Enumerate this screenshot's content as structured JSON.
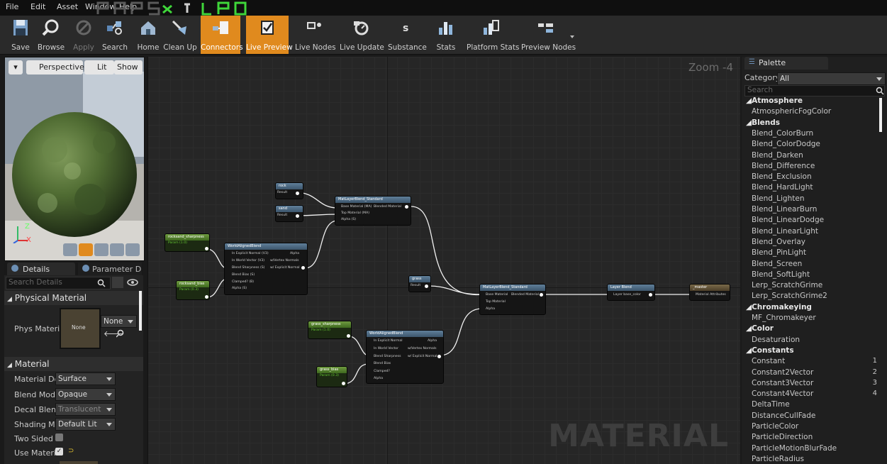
{
  "menu": {
    "file": "File",
    "edit": "Edit",
    "asset": "Asset",
    "window": "Window",
    "help": "Help"
  },
  "toolbar": {
    "save": "Save",
    "browse": "Browse",
    "apply": "Apply",
    "search": "Search",
    "home": "Home",
    "cleanup": "Clean Up",
    "connectors": "Connectors",
    "live_preview": "Live Preview",
    "live_nodes": "Live Nodes",
    "live_update": "Live Update",
    "substance": "Substance",
    "stats": "Stats",
    "platform_stats": "Platform Stats",
    "preview_nodes": "Preview Nodes"
  },
  "viewport": {
    "perspective": "Perspective",
    "lit": "Lit",
    "show": "Show",
    "axis_z": "Z",
    "axis_x": "X"
  },
  "details": {
    "tab_details": "Details",
    "tab_params": "Parameter D",
    "search_placeholder": "Search Details",
    "physical_section": "Physical Material",
    "phys_label": "Phys Materi",
    "phys_thumb": "None",
    "phys_value": "None",
    "material_section": "Material",
    "domain_label": "Material Dor",
    "domain_value": "Surface",
    "blend_label": "Blend Mode",
    "blend_value": "Opaque",
    "decal_label": "Decal Blend",
    "decal_value": "Translucent",
    "shading_label": "Shading Mo",
    "shading_value": "Default Lit",
    "twosided_label": "Two Sided",
    "usemat_label": "Use Materia"
  },
  "graph": {
    "zoom": "Zoom -4",
    "watermark": "MATERIAL",
    "nodes": {
      "rock": {
        "title": "rock",
        "out": "Result"
      },
      "sand": {
        "title": "sand",
        "out": "Result"
      },
      "blend1": {
        "title": "MatLayerBlend_Standard",
        "p1": "Base Material (MA)",
        "o1": "Blended Material",
        "p2": "Top Material (MA)",
        "p3": "Alpha (S)"
      },
      "rocksharp": {
        "title": "rocksand_sharpness",
        "sub": "Param (1.0)"
      },
      "rockbias": {
        "title": "rocksand_bias",
        "sub": "Param (0.3)"
      },
      "wab1": {
        "title": "WorldAlignedBlend",
        "p1": "In Explicit Normal (V3)",
        "o1": "Alpha",
        "p2": "In World Vector (V3)",
        "o2": "w/Vertex Normals",
        "p3": "Blend Sharpness (S)",
        "o3": "w/ Explicit Normal",
        "p4": "Blend Bias (S)",
        "p5": "Clamped? (B)",
        "p6": "Alpha (S)"
      },
      "grass": {
        "title": "grass",
        "out": "Result"
      },
      "blend2": {
        "title": "MatLayerBlend_Standard",
        "p1": "Base Material",
        "o1": "Blended Material",
        "p2": "Top Material",
        "p3": "Alpha"
      },
      "grasssharp": {
        "title": "grass_sharpness",
        "sub": "Param (1.0)"
      },
      "grassbias": {
        "title": "grass_bias",
        "sub": "Param (0.3)"
      },
      "wab2": {
        "title": "WorldAlignedBlend",
        "p1": "In Explicit Normal",
        "o1": "Alpha",
        "p2": "In World Vector",
        "o2": "w/Vertex Normals",
        "p3": "Blend Sharpness",
        "o3": "w/ Explicit Normal",
        "p4": "Blend Bias",
        "p5": "Clamped?",
        "p6": "Alpha"
      },
      "layer": {
        "title": "Layer Blend",
        "p1": "Layer base_color"
      },
      "master": {
        "title": "_master",
        "p1": "Material Attributes"
      }
    }
  },
  "palette": {
    "tab": "Palette",
    "category_label": "Category",
    "category_value": "All",
    "search_placeholder": "Search",
    "items": [
      {
        "t": "c",
        "text": "Atmosphere"
      },
      {
        "t": "i",
        "text": "AtmosphericFogColor"
      },
      {
        "t": "c",
        "text": "Blends"
      },
      {
        "t": "i",
        "text": "Blend_ColorBurn"
      },
      {
        "t": "i",
        "text": "Blend_ColorDodge"
      },
      {
        "t": "i",
        "text": "Blend_Darken"
      },
      {
        "t": "i",
        "text": "Blend_Difference"
      },
      {
        "t": "i",
        "text": "Blend_Exclusion"
      },
      {
        "t": "i",
        "text": "Blend_HardLight"
      },
      {
        "t": "i",
        "text": "Blend_Lighten"
      },
      {
        "t": "i",
        "text": "Blend_LinearBurn"
      },
      {
        "t": "i",
        "text": "Blend_LinearDodge"
      },
      {
        "t": "i",
        "text": "Blend_LinearLight"
      },
      {
        "t": "i",
        "text": "Blend_Overlay"
      },
      {
        "t": "i",
        "text": "Blend_PinLight"
      },
      {
        "t": "i",
        "text": "Blend_Screen"
      },
      {
        "t": "i",
        "text": "Blend_SoftLight"
      },
      {
        "t": "i",
        "text": "Lerp_ScratchGrime"
      },
      {
        "t": "i",
        "text": "Lerp_ScratchGrime2"
      },
      {
        "t": "c",
        "text": "Chromakeying"
      },
      {
        "t": "i",
        "text": "MF_Chromakeyer"
      },
      {
        "t": "c",
        "text": "Color"
      },
      {
        "t": "i",
        "text": "Desaturation"
      },
      {
        "t": "c",
        "text": "Constants"
      },
      {
        "t": "i",
        "text": "Constant",
        "n": "1"
      },
      {
        "t": "i",
        "text": "Constant2Vector",
        "n": "2"
      },
      {
        "t": "i",
        "text": "Constant3Vector",
        "n": "3"
      },
      {
        "t": "i",
        "text": "Constant4Vector",
        "n": "4"
      },
      {
        "t": "i",
        "text": "DeltaTime"
      },
      {
        "t": "i",
        "text": "DistanceCullFade"
      },
      {
        "t": "i",
        "text": "ParticleColor"
      },
      {
        "t": "i",
        "text": "ParticleDirection"
      },
      {
        "t": "i",
        "text": "ParticleMotionBlurFade"
      },
      {
        "t": "i",
        "text": "ParticleRadius"
      }
    ]
  },
  "colors": {
    "accent": "#e08a1e",
    "logo_green": "#3fd63a"
  }
}
